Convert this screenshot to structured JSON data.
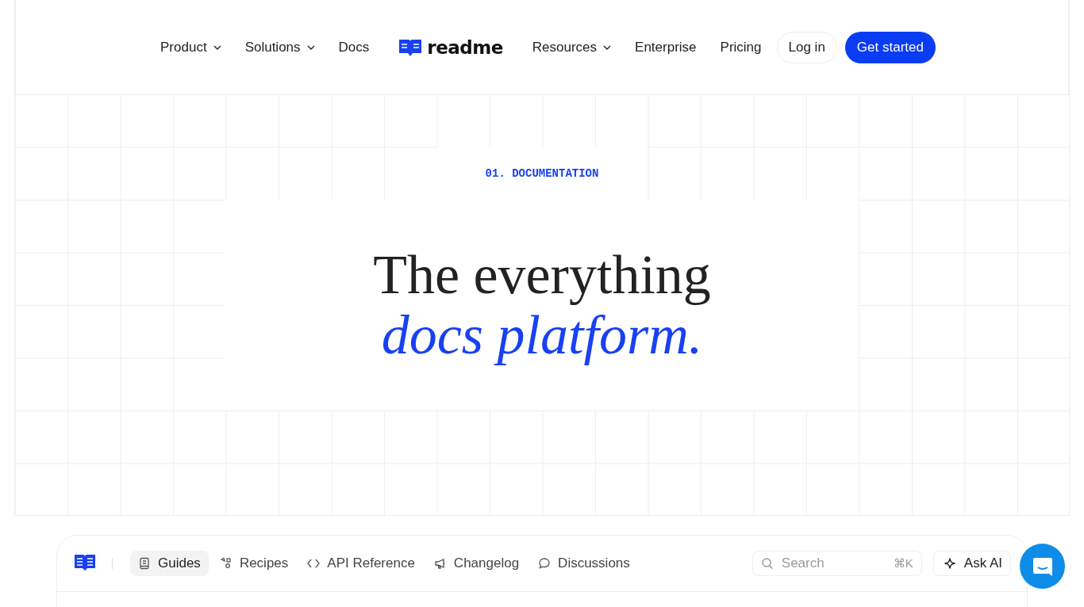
{
  "nav": {
    "left": [
      {
        "label": "Product",
        "has_menu": true
      },
      {
        "label": "Solutions",
        "has_menu": true
      },
      {
        "label": "Docs",
        "has_menu": false
      }
    ],
    "logo": "readme",
    "right": [
      {
        "label": "Resources",
        "has_menu": true
      },
      {
        "label": "Enterprise",
        "has_menu": false
      },
      {
        "label": "Pricing",
        "has_menu": false
      }
    ],
    "login": "Log in",
    "cta": "Get started"
  },
  "hero": {
    "eyebrow": "01. DOCUMENTATION",
    "title": "The everything",
    "title_accent": "docs platform."
  },
  "preview": {
    "tabs": [
      {
        "label": "Guides",
        "kind": "guides",
        "selected": true
      },
      {
        "label": "Recipes",
        "kind": "recipes",
        "selected": false
      },
      {
        "label": "API Reference",
        "kind": "api",
        "selected": false
      },
      {
        "label": "Changelog",
        "kind": "changelog",
        "selected": false
      },
      {
        "label": "Discussions",
        "kind": "discussions",
        "selected": false
      }
    ],
    "search": {
      "placeholder": "Search",
      "shortcut": "⌘K"
    },
    "ask_ai": "Ask AI"
  }
}
